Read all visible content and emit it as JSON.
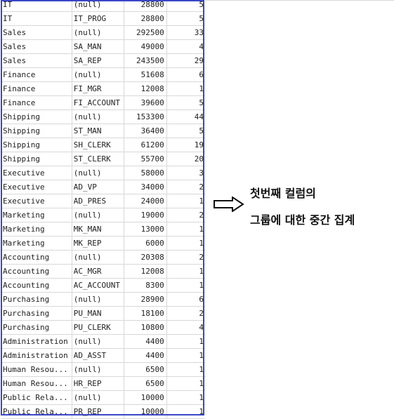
{
  "rows": [
    [
      "IT",
      "(null)",
      "28800",
      "5"
    ],
    [
      "IT",
      "IT_PROG",
      "28800",
      "5"
    ],
    [
      "Sales",
      "(null)",
      "292500",
      "33"
    ],
    [
      "Sales",
      "SA_MAN",
      "49000",
      "4"
    ],
    [
      "Sales",
      "SA_REP",
      "243500",
      "29"
    ],
    [
      "Finance",
      "(null)",
      "51608",
      "6"
    ],
    [
      "Finance",
      "FI_MGR",
      "12008",
      "1"
    ],
    [
      "Finance",
      "FI_ACCOUNT",
      "39600",
      "5"
    ],
    [
      "Shipping",
      "(null)",
      "153300",
      "44"
    ],
    [
      "Shipping",
      "ST_MAN",
      "36400",
      "5"
    ],
    [
      "Shipping",
      "SH_CLERK",
      "61200",
      "19"
    ],
    [
      "Shipping",
      "ST_CLERK",
      "55700",
      "20"
    ],
    [
      "Executive",
      "(null)",
      "58000",
      "3"
    ],
    [
      "Executive",
      "AD_VP",
      "34000",
      "2"
    ],
    [
      "Executive",
      "AD_PRES",
      "24000",
      "1"
    ],
    [
      "Marketing",
      "(null)",
      "19000",
      "2"
    ],
    [
      "Marketing",
      "MK_MAN",
      "13000",
      "1"
    ],
    [
      "Marketing",
      "MK_REP",
      "6000",
      "1"
    ],
    [
      "Accounting",
      "(null)",
      "20308",
      "2"
    ],
    [
      "Accounting",
      "AC_MGR",
      "12008",
      "1"
    ],
    [
      "Accounting",
      "AC_ACCOUNT",
      "8300",
      "1"
    ],
    [
      "Purchasing",
      "(null)",
      "28900",
      "6"
    ],
    [
      "Purchasing",
      "PU_MAN",
      "18100",
      "2"
    ],
    [
      "Purchasing",
      "PU_CLERK",
      "10800",
      "4"
    ],
    [
      "Administration",
      "(null)",
      "4400",
      "1"
    ],
    [
      "Administration",
      "AD_ASST",
      "4400",
      "1"
    ],
    [
      "Human Resou...",
      "(null)",
      "6500",
      "1"
    ],
    [
      "Human Resou...",
      "HR_REP",
      "6500",
      "1"
    ],
    [
      "Public Rela...",
      "(null)",
      "10000",
      "1"
    ],
    [
      "Public Rela...",
      "PR_REP",
      "10000",
      "1"
    ]
  ],
  "annotation": {
    "line1": "첫번째 컬럼의",
    "line2": "그룹에 대한 중간 집계",
    "arrow_icon": "right-arrow-icon",
    "highlight_color": "#3a47c8"
  }
}
